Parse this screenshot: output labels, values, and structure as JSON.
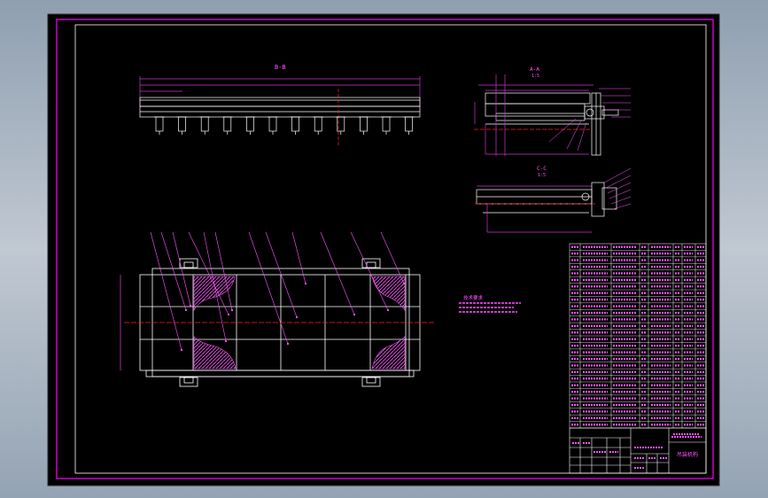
{
  "colors": {
    "background": "#000000",
    "frame": "#ff00ff",
    "geometry": "#ffffff",
    "centerline": "#ff2020",
    "hatch": "#ff55ff",
    "dimension": "#cc33cc",
    "canvas_border": "#2b2b2b"
  },
  "views": {
    "view_b_title": "B-B",
    "view_a_title": "A-A",
    "view_a_scale": "1:5",
    "view_c_title": "C-C",
    "view_c_scale": "1:5"
  },
  "plan_view": {
    "note_title": "技术要求"
  },
  "title_block": {
    "drawing_name": "吊装机构"
  }
}
